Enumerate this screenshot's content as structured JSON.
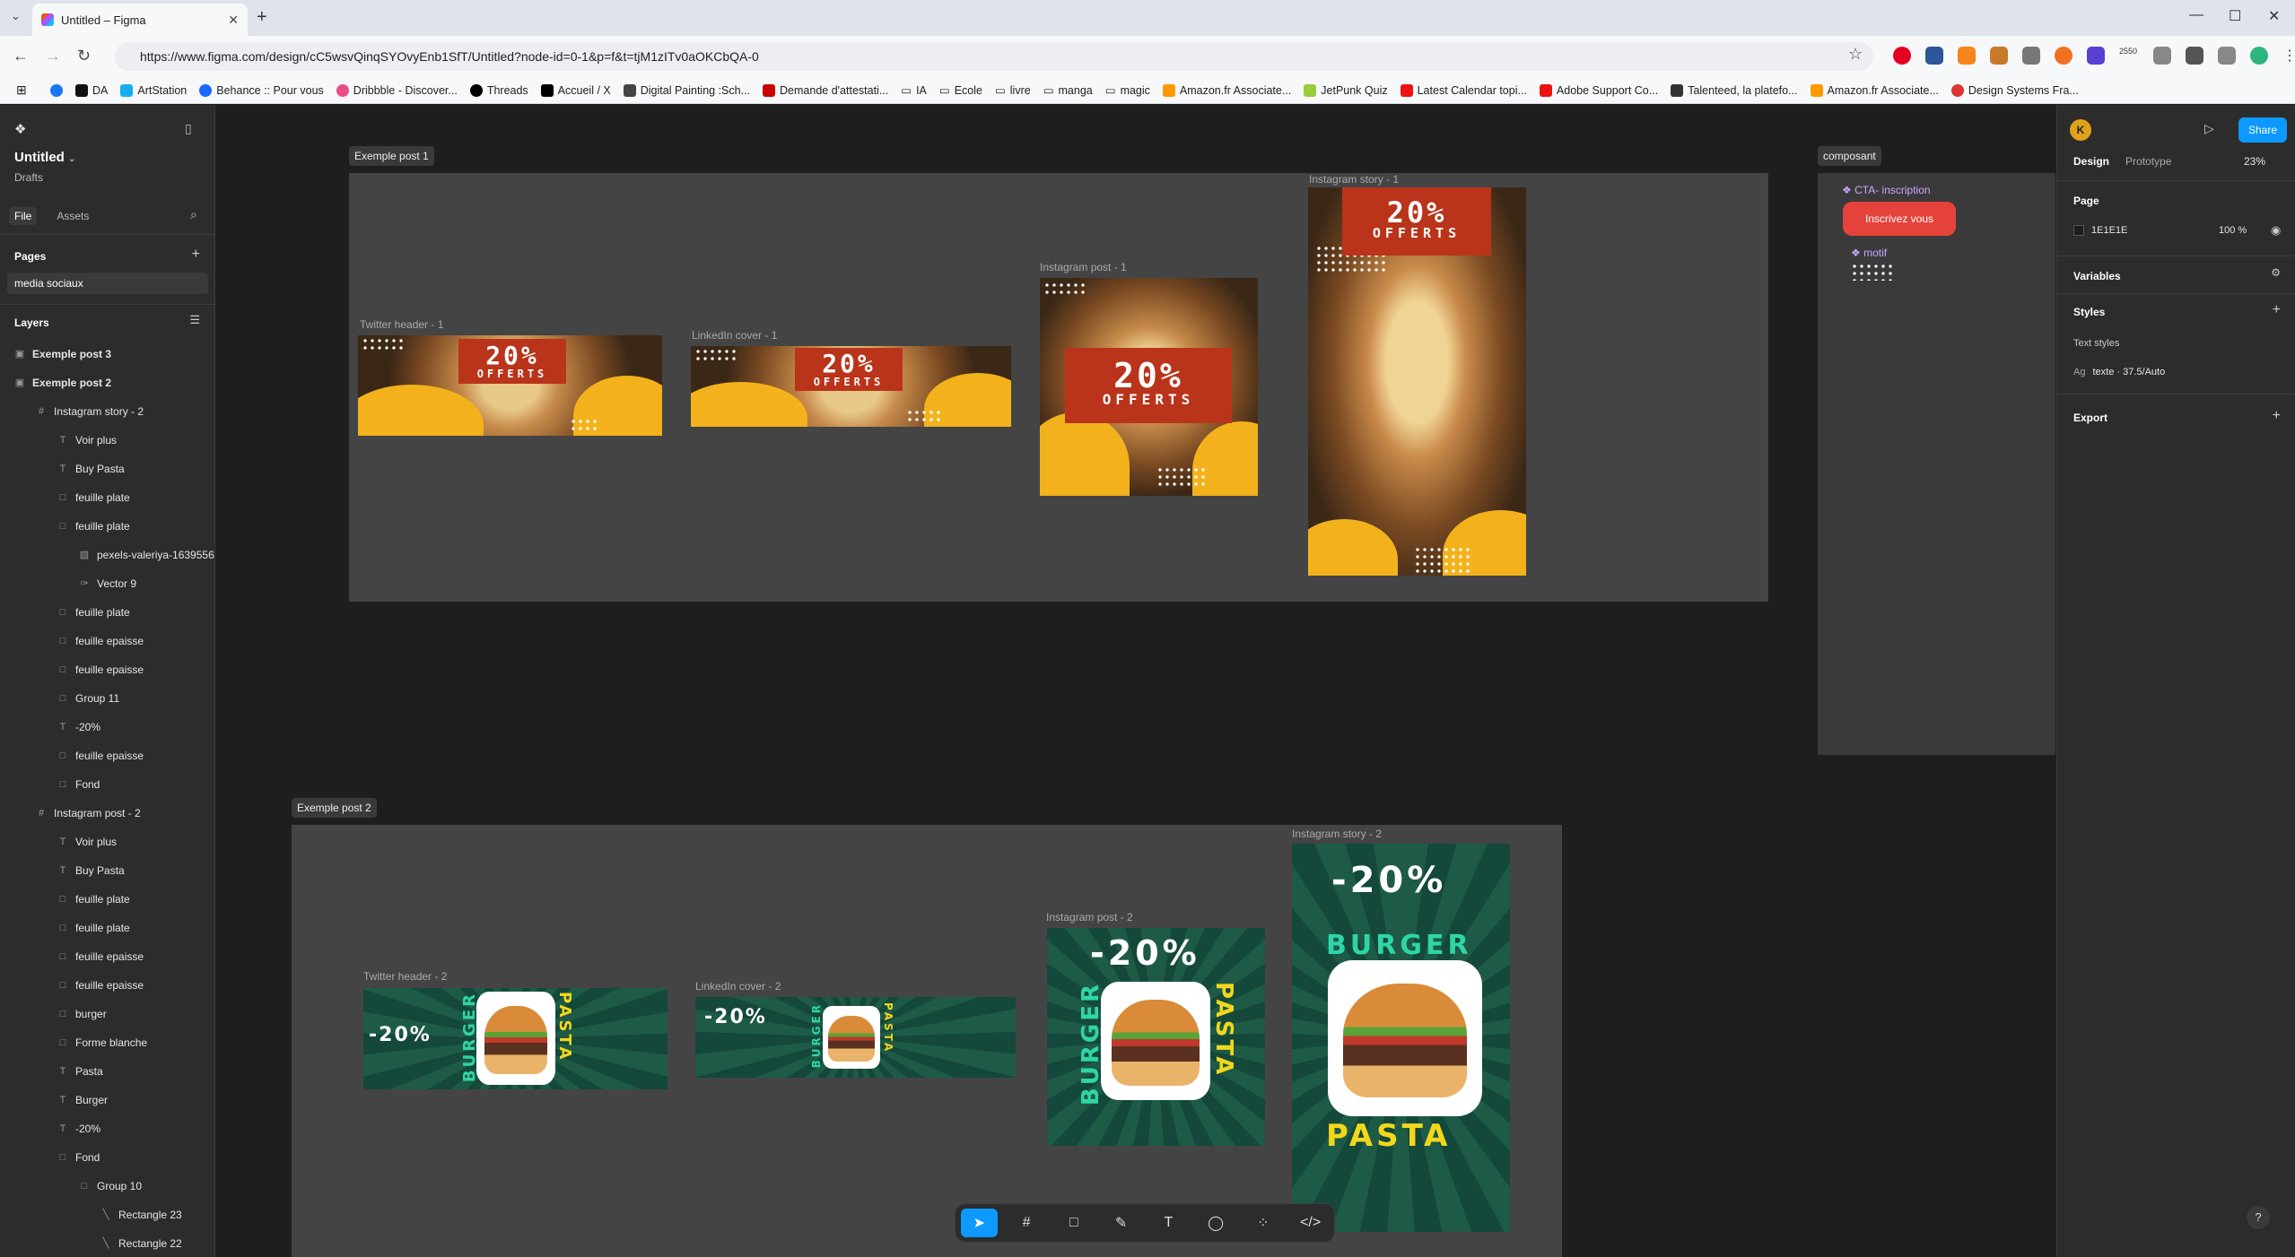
{
  "browser": {
    "tab_title": "Untitled – Figma",
    "url": "https://www.figma.com/design/cC5wsvQinqSYOvyEnb1SfT/Untitled?node-id=0-1&p=f&t=tjM1zITv0aOKCbQA-0",
    "bookmarks": [
      "DA",
      "ArtStation",
      "Behance :: Pour vous",
      "Dribbble - Discover...",
      "Threads",
      "Accueil / X",
      "Digital Painting :Sch...",
      "Demande d'attestati...",
      "IA",
      "Ecole",
      "livre",
      "manga",
      "magic",
      "Amazon.fr Associate...",
      "JetPunk Quiz",
      "Latest Calendar topi...",
      "Adobe Support Co...",
      "Talenteed, la platefo...",
      "Amazon.fr Associate...",
      "Design Systems Fra..."
    ],
    "extension_badge": "2550"
  },
  "left_panel": {
    "file_title": "Untitled",
    "drafts": "Drafts",
    "tab_file": "File",
    "tab_assets": "Assets",
    "pages_heading": "Pages",
    "page_item": "media sociaux",
    "layers_heading": "Layers",
    "layers": [
      {
        "label": "Exemple post 3",
        "icon": "section-icon",
        "indent": 0
      },
      {
        "label": "Exemple post 2",
        "icon": "section-icon",
        "indent": 0
      },
      {
        "label": "Instagram story - 2",
        "icon": "frame-icon",
        "indent": 1
      },
      {
        "label": "Voir plus",
        "icon": "text-icon",
        "indent": 2
      },
      {
        "label": "Buy Pasta",
        "icon": "text-icon",
        "indent": 2
      },
      {
        "label": "feuille plate",
        "icon": "rect-icon",
        "indent": 2
      },
      {
        "label": "feuille plate",
        "icon": "rect-icon",
        "indent": 2
      },
      {
        "label": "pexels-valeriya-1639556",
        "icon": "image-icon",
        "indent": 3
      },
      {
        "label": "Vector 9",
        "icon": "vector-icon",
        "indent": 3
      },
      {
        "label": "feuille plate",
        "icon": "rect-icon",
        "indent": 2
      },
      {
        "label": "feuille epaisse",
        "icon": "rect-icon",
        "indent": 2
      },
      {
        "label": "feuille epaisse",
        "icon": "rect-icon",
        "indent": 2
      },
      {
        "label": "Group 11",
        "icon": "rect-icon",
        "indent": 2
      },
      {
        "label": "-20%",
        "icon": "text-icon",
        "indent": 2
      },
      {
        "label": "feuille epaisse",
        "icon": "rect-icon",
        "indent": 2
      },
      {
        "label": "Fond",
        "icon": "rect-icon",
        "indent": 2
      },
      {
        "label": "Instagram post - 2",
        "icon": "frame-icon",
        "indent": 1
      },
      {
        "label": "Voir plus",
        "icon": "text-icon",
        "indent": 2
      },
      {
        "label": "Buy Pasta",
        "icon": "text-icon",
        "indent": 2
      },
      {
        "label": "feuille plate",
        "icon": "rect-icon",
        "indent": 2
      },
      {
        "label": "feuille plate",
        "icon": "rect-icon",
        "indent": 2
      },
      {
        "label": "feuille epaisse",
        "icon": "rect-icon",
        "indent": 2
      },
      {
        "label": "feuille epaisse",
        "icon": "rect-icon",
        "indent": 2
      },
      {
        "label": "burger",
        "icon": "rect-icon",
        "indent": 2
      },
      {
        "label": "Forme blanche",
        "icon": "rect-icon",
        "indent": 2
      },
      {
        "label": "Pasta",
        "icon": "text-icon",
        "indent": 2
      },
      {
        "label": "Burger",
        "icon": "text-icon",
        "indent": 2
      },
      {
        "label": "-20%",
        "icon": "text-icon",
        "indent": 2
      },
      {
        "label": "Fond",
        "icon": "rect-icon",
        "indent": 2
      },
      {
        "label": "Group 10",
        "icon": "rect-icon",
        "indent": 3
      },
      {
        "label": "Rectangle 23",
        "icon": "line-icon",
        "indent": 4
      },
      {
        "label": "Rectangle 22",
        "icon": "line-icon",
        "indent": 4
      }
    ]
  },
  "canvas": {
    "section1_label": "Exemple post 1",
    "section2_label": "Exemple post 2",
    "components_label": "composant",
    "frames1": {
      "twitter": "Twitter header - 1",
      "linkedin": "LinkedIn cover - 1",
      "insta_post": "Instagram post - 1",
      "insta_story": "Instagram story - 1"
    },
    "frames2": {
      "twitter": "Twitter header - 2",
      "linkedin": "LinkedIn cover - 2",
      "insta_post": "Instagram post - 2",
      "insta_story": "Instagram story - 2"
    },
    "promo1_pct": "20%",
    "promo1_word": "OFFERTS",
    "promo2_pct": "-20%",
    "promo2_burger": "BURGER",
    "promo2_pasta": "PASTA",
    "component_cta": "CTA- inscription",
    "component_cta_button": "Inscrivez vous",
    "component_motif": "motif"
  },
  "right_panel": {
    "avatar": "K",
    "share": "Share",
    "tab_design": "Design",
    "tab_prototype": "Prototype",
    "zoom": "23%",
    "page_heading": "Page",
    "page_color": "1E1E1E",
    "page_opacity": "100",
    "page_opacity_unit": "%",
    "variables": "Variables",
    "styles": "Styles",
    "text_styles": "Text styles",
    "text_style_prefix": "Ag",
    "text_style_name": "texte",
    "text_style_spec": "37.5/Auto",
    "export": "Export"
  },
  "colors": {
    "accent": "#0d99ff",
    "cta_red": "#e5423b",
    "promo_orange": "#b9341a",
    "yellow": "#f3b21b",
    "green": "#1d5b47"
  }
}
